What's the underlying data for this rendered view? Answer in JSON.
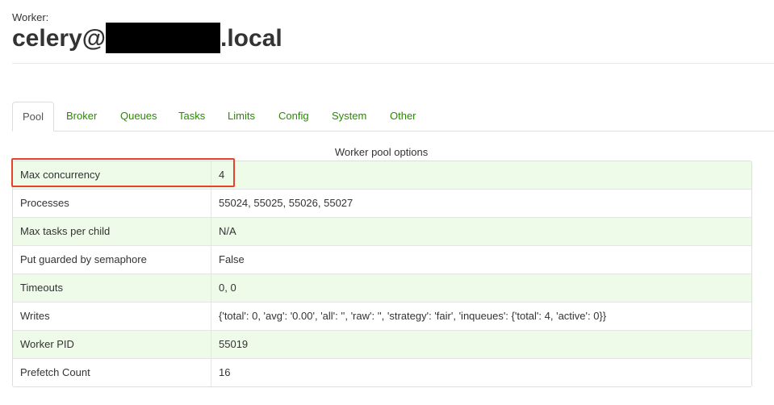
{
  "header": {
    "label": "Worker:",
    "name_prefix": "celery@",
    "name_suffix": ".local"
  },
  "tabs": [
    {
      "label": "Pool",
      "active": true
    },
    {
      "label": "Broker",
      "active": false
    },
    {
      "label": "Queues",
      "active": false
    },
    {
      "label": "Tasks",
      "active": false
    },
    {
      "label": "Limits",
      "active": false
    },
    {
      "label": "Config",
      "active": false
    },
    {
      "label": "System",
      "active": false
    },
    {
      "label": "Other",
      "active": false
    }
  ],
  "pool": {
    "caption": "Worker pool options",
    "rows": [
      {
        "key": "Max concurrency",
        "value": "4"
      },
      {
        "key": "Processes",
        "value": "55024, 55025, 55026, 55027"
      },
      {
        "key": "Max tasks per child",
        "value": "N/A"
      },
      {
        "key": "Put guarded by semaphore",
        "value": "False"
      },
      {
        "key": "Timeouts",
        "value": "0, 0"
      },
      {
        "key": "Writes",
        "value": "{'total': 0, 'avg': '0.00', 'all': '', 'raw': '', 'strategy': 'fair', 'inqueues': {'total': 4, 'active': 0}}"
      },
      {
        "key": "Worker PID",
        "value": "55019"
      },
      {
        "key": "Prefetch Count",
        "value": "16"
      }
    ]
  },
  "colors": {
    "link_green": "#2a8a00",
    "row_stripe": "#eefbe8",
    "highlight_red": "#e8412c"
  }
}
